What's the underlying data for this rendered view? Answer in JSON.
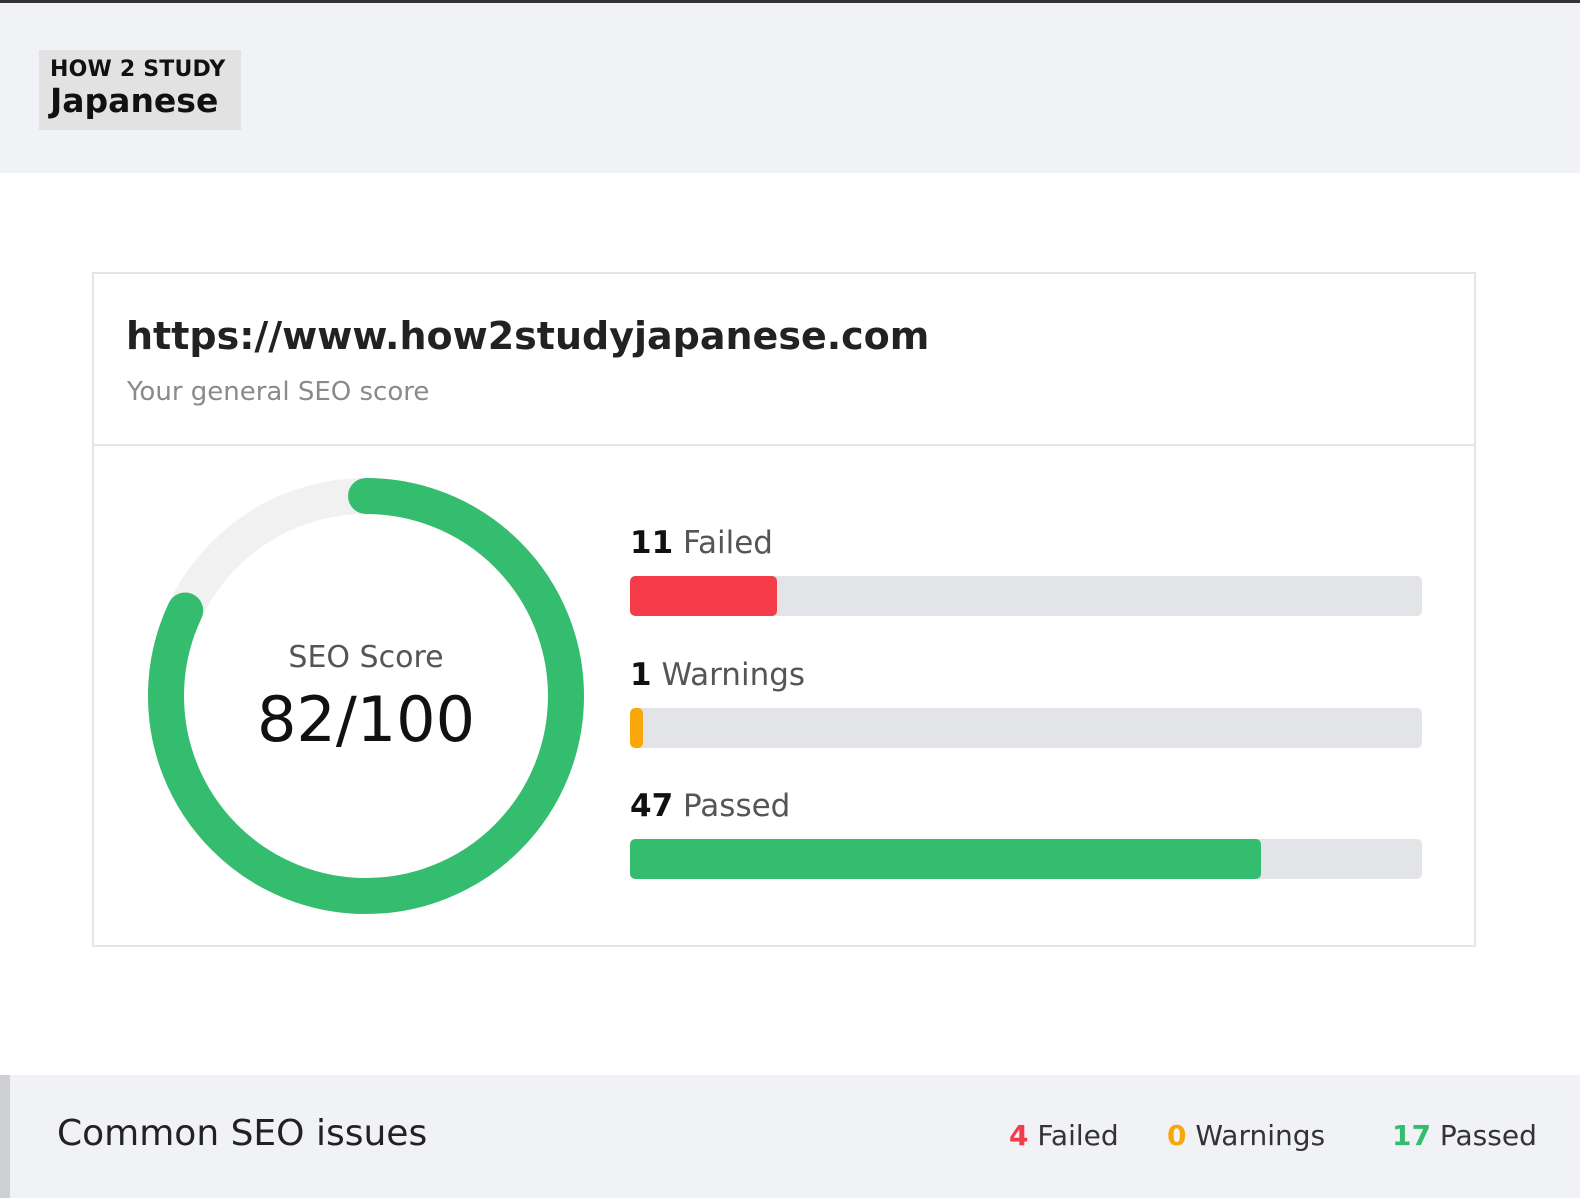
{
  "colors": {
    "failed": "#f43b47",
    "warning": "#f8a708",
    "passed": "#35bd6f",
    "track": "#e2e4e7",
    "gauge_track": "#f1f1f1"
  },
  "header": {
    "logo": {
      "line1": "HOW 2 STUDY",
      "line2": "Japanese"
    }
  },
  "summary": {
    "url": "https://www.how2studyjapanese.com",
    "subtitle": "Your general SEO score",
    "gauge": {
      "label": "SEO Score",
      "value_text": "82/100",
      "score": 82,
      "max": 100
    },
    "stats": [
      {
        "count": "11",
        "label": "Failed",
        "fraction": 0.186,
        "color_key": "failed"
      },
      {
        "count": "1",
        "label": "Warnings",
        "fraction": 0.017,
        "color_key": "warning"
      },
      {
        "count": "47",
        "label": "Passed",
        "fraction": 0.797,
        "color_key": "passed"
      }
    ]
  },
  "section": {
    "title": "Common SEO issues",
    "failed_count": "4",
    "failed_label": "Failed",
    "warnings_count": "0",
    "warnings_label": "Warnings",
    "passed_count": "17",
    "passed_label": "Passed"
  }
}
